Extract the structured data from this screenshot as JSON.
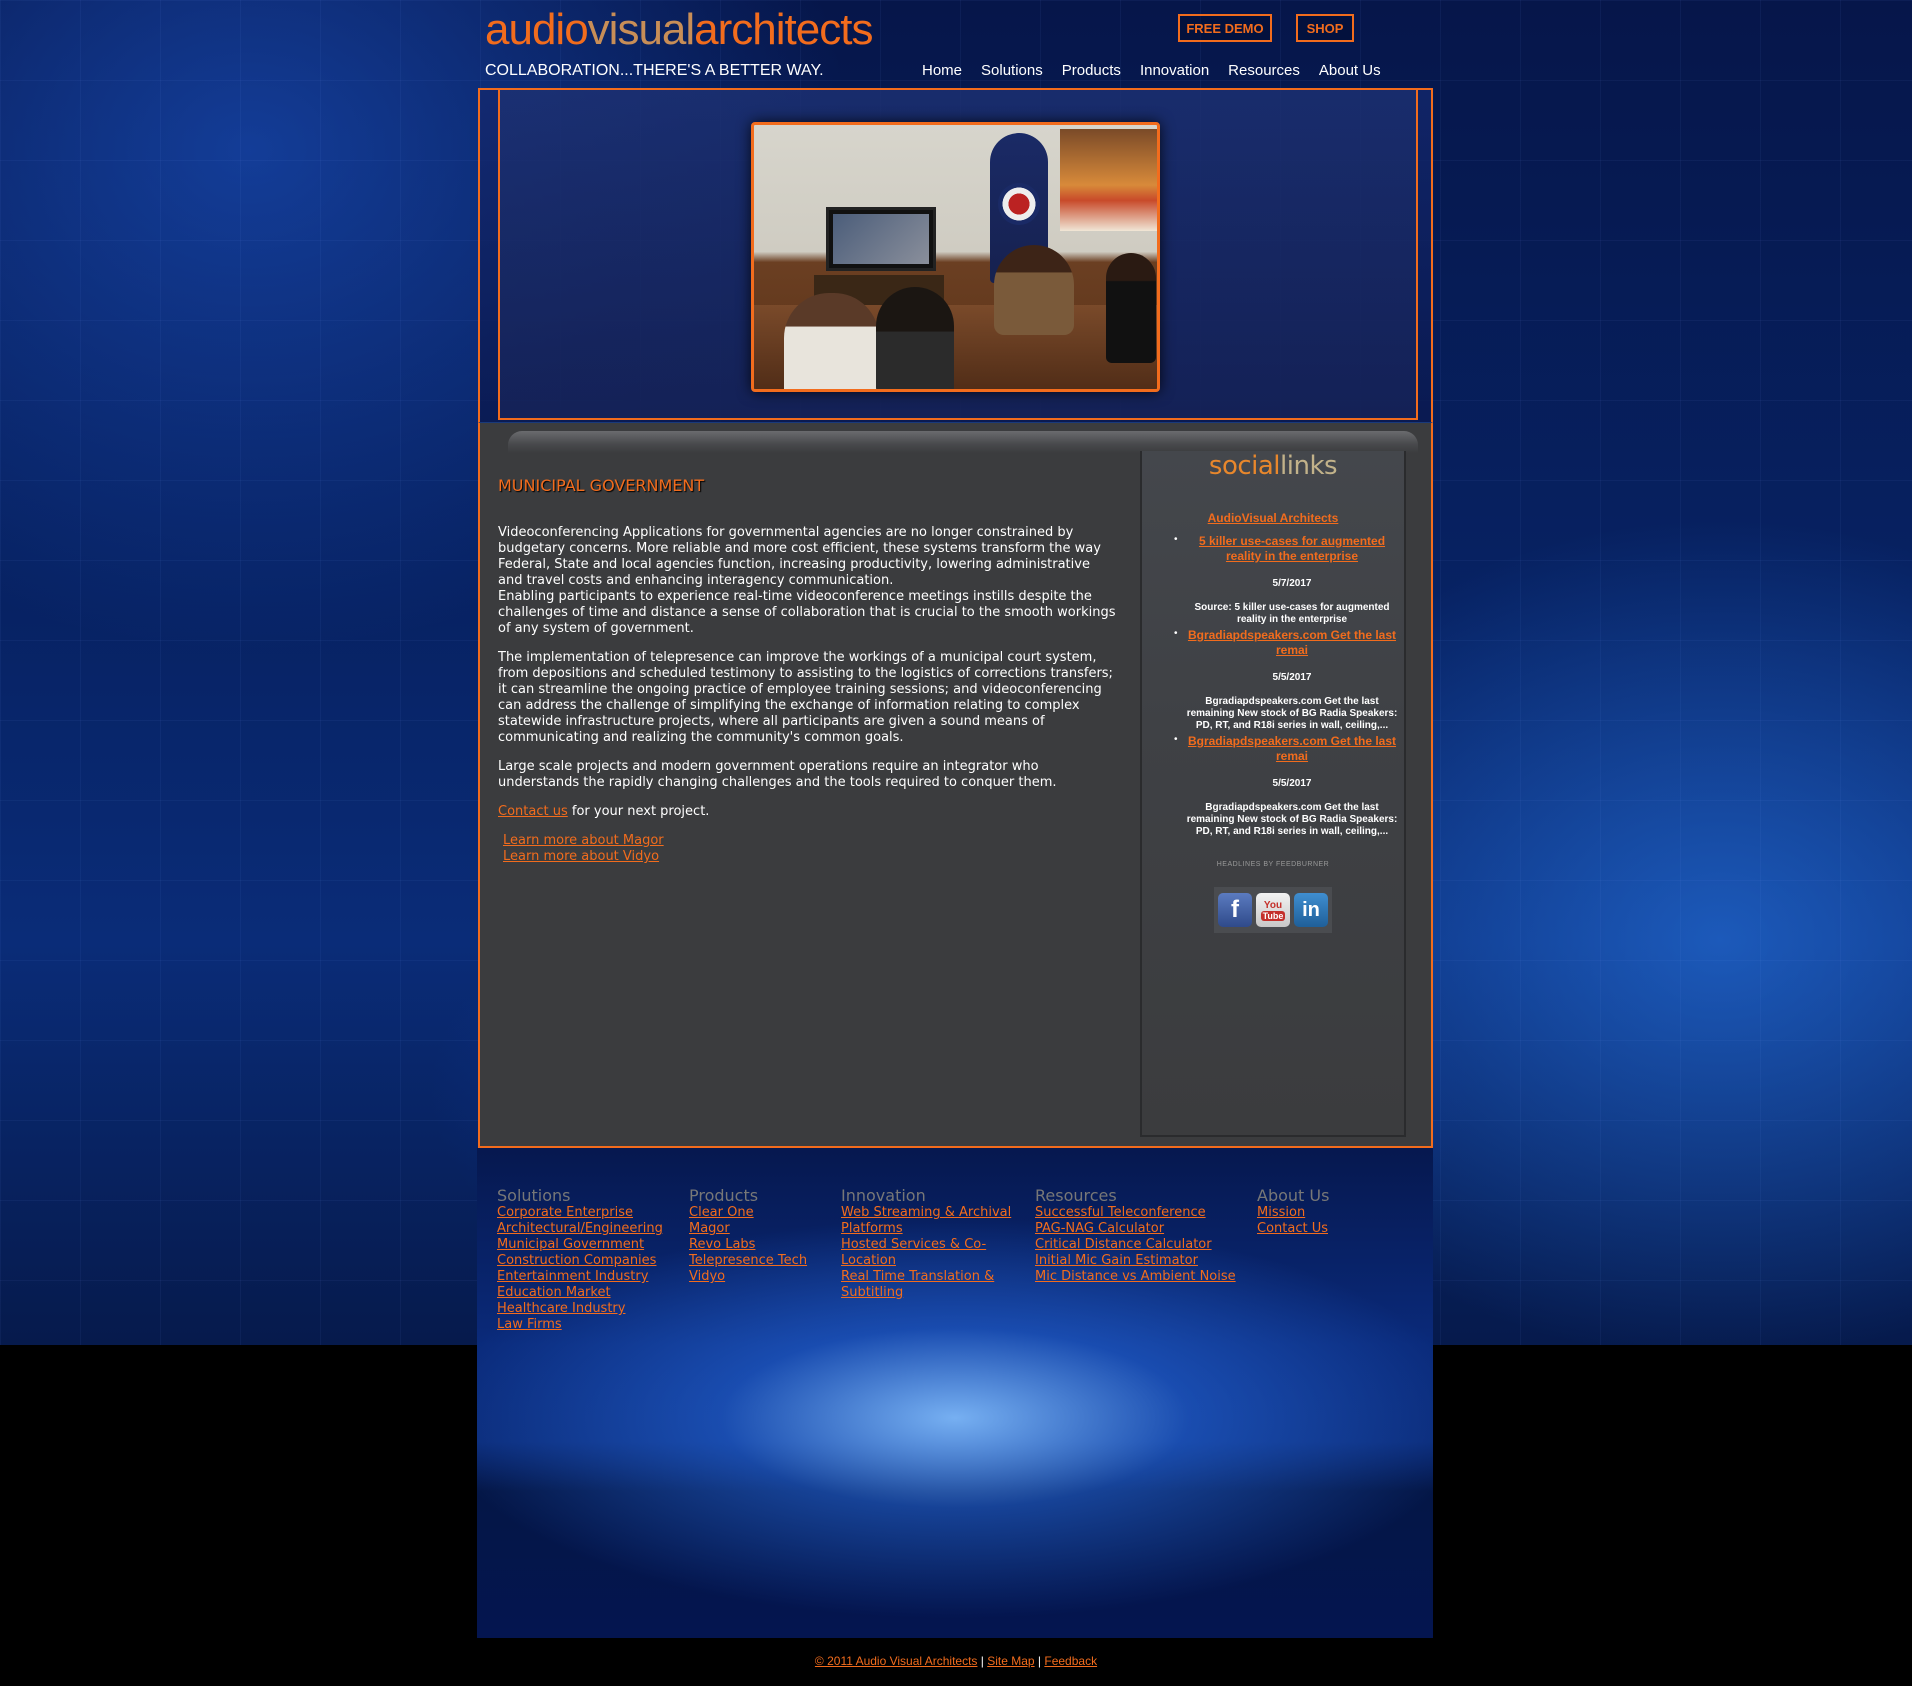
{
  "logo": {
    "part1": "audio",
    "part2": "visual",
    "part3": "architects"
  },
  "tagline": "COLLABORATION...THERE'S A BETTER WAY.",
  "header_buttons": {
    "free_demo": "FREE DEMO",
    "shop": "SHOP"
  },
  "nav": [
    "Home",
    "Solutions",
    "Products",
    "Innovation",
    "Resources",
    "About Us"
  ],
  "main": {
    "title": "MUNICIPAL GOVERNMENT",
    "para1a": "Videoconferencing Applications for governmental agencies are no longer constrained by budgetary concerns. More reliable and more cost efficient, these systems transform the way Federal, State and local agencies function, increasing productivity, lowering administrative and travel costs and enhancing interagency communication.",
    "para1b": "Enabling participants to experience real-time videoconference meetings instills despite the challenges of time and distance a sense of collaboration that is crucial to the smooth workings of any system of government.",
    "para2": "The implementation of telepresence can improve the workings of a municipal court system, from depositions and scheduled testimony to assisting to the logistics of corrections transfers; it can streamline the ongoing practice of employee training sessions;  and videoconferencing can address the challenge of simplifying the exchange of information relating to complex statewide infrastructure projects, where all participants are given a sound means of communicating and realizing the community's common goals.",
    "para3": "Large scale projects and modern government operations require an integrator who understands the rapidly changing challenges and the tools required to conquer them.",
    "contact_link": "Contact us",
    "contact_rest": " for your next project.",
    "learn_magor": "Learn more about Magor",
    "learn_vidyo": "Learn more about Vidyo"
  },
  "sidebar": {
    "title_a": "social",
    "title_b": "links",
    "feed_title": "AudioVisual Architects",
    "items": [
      {
        "link": "5 killer use-cases for augmented reality in the enterprise",
        "date": "5/7/2017",
        "desc": "Source: 5 killer use-cases for augmented reality in the enterprise"
      },
      {
        "link": "Bgradiapdspeakers.com Get the last remai",
        "date": "5/5/2017",
        "desc": "Bgradiapdspeakers.com Get the last remaining New stock of BG Radia Speakers: PD, RT, and R18i series in wall, ceiling,..."
      },
      {
        "link": "Bgradiapdspeakers.com Get the last remai",
        "date": "5/5/2017",
        "desc": "Bgradiapdspeakers.com Get the last remaining New stock of BG Radia Speakers: PD, RT, and R18i series in wall, ceiling,..."
      }
    ],
    "headlines": "HEADLINES BY FEEDBURNER",
    "social_icons": [
      "facebook-icon",
      "youtube-icon",
      "linkedin-icon"
    ]
  },
  "footer": {
    "solutions": {
      "heading": "Solutions",
      "links": [
        "Corporate Enterprise",
        "Architectural/Engineering",
        "Municipal Government",
        "Construction Companies",
        "Entertainment Industry",
        "Education Market",
        "Healthcare Industry",
        "Law Firms"
      ]
    },
    "products": {
      "heading": "Products",
      "links": [
        "Clear One",
        "Magor",
        "Revo Labs",
        "Telepresence Tech",
        "Vidyo"
      ]
    },
    "innovation": {
      "heading": "Innovation",
      "links": [
        "Web Streaming & Archival",
        "Platforms",
        "Hosted Services & Co-",
        "Location",
        "Real Time Translation &",
        "Subtitling"
      ]
    },
    "resources": {
      "heading": "Resources",
      "links": [
        "Successful Teleconference",
        "PAG-NAG Calculator",
        "Critical Distance Calculator",
        "Initial Mic Gain Estimator",
        "Mic Distance vs Ambient Noise"
      ]
    },
    "about": {
      "heading": "About Us",
      "links": [
        "Mission",
        "Contact Us"
      ]
    }
  },
  "copyright": {
    "text": "© 2011 Audio Visual Architects",
    "sitemap": "Site Map",
    "feedback": "Feedback",
    "sep": " | "
  },
  "colors": {
    "accent": "#f26c1d",
    "content_bg": "#3b3c3e",
    "page_bg": "#072263"
  }
}
